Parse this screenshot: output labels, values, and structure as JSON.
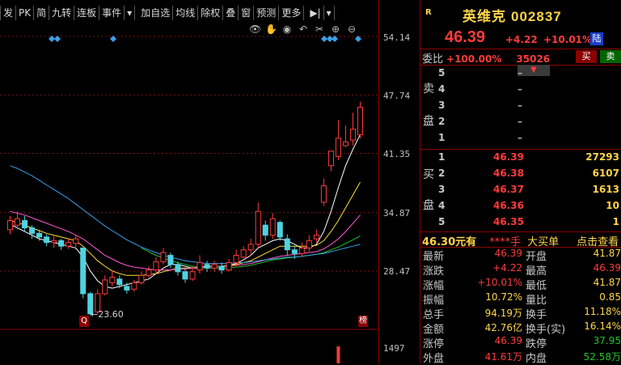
{
  "toolbar": {
    "items": [
      "发",
      "PK",
      "简",
      "九转",
      "连板",
      "事件",
      "▾",
      "加自选",
      "均线",
      "除权",
      "叠",
      "窗",
      "预测",
      "更多",
      "▶|",
      "▾"
    ]
  },
  "chart": {
    "price_axis": [
      "54.14",
      "47.74",
      "41.35",
      "34.87",
      "28.47"
    ],
    "volume_axis": "1497",
    "low_marker": "←23.60",
    "badge_low": "Q",
    "badge_high": "榜",
    "tool_icons": [
      "eye-icon",
      "hand-icon",
      "replay-icon",
      "undo-icon",
      "scissors-icon",
      "plus-circle-icon",
      "minus-circle-icon"
    ]
  },
  "chart_data": {
    "type": "candlestick",
    "y_axis_ticks": [
      28.47,
      34.87,
      41.35,
      47.74,
      54.14
    ],
    "lowest_price": 23.6,
    "candles": [
      {
        "o": 33.0,
        "c": 34.0,
        "h": 34.5,
        "l": 32.5
      },
      {
        "o": 33.5,
        "c": 34.2,
        "h": 35.0,
        "l": 33.0
      },
      {
        "o": 34.0,
        "c": 33.2,
        "h": 34.5,
        "l": 32.8
      },
      {
        "o": 33.2,
        "c": 32.6,
        "h": 33.5,
        "l": 32.0
      },
      {
        "o": 32.6,
        "c": 32.2,
        "h": 33.0,
        "l": 31.8
      },
      {
        "o": 32.2,
        "c": 31.6,
        "h": 32.5,
        "l": 31.2
      },
      {
        "o": 31.6,
        "c": 31.8,
        "h": 32.3,
        "l": 31.0
      },
      {
        "o": 31.8,
        "c": 31.2,
        "h": 32.0,
        "l": 30.8
      },
      {
        "o": 31.2,
        "c": 31.6,
        "h": 32.0,
        "l": 30.9
      },
      {
        "o": 31.5,
        "c": 32.0,
        "h": 32.4,
        "l": 31.1
      },
      {
        "o": 31.0,
        "c": 26.0,
        "h": 31.0,
        "l": 25.5
      },
      {
        "o": 26.0,
        "c": 23.8,
        "h": 26.2,
        "l": 23.6
      },
      {
        "o": 24.0,
        "c": 26.0,
        "h": 26.5,
        "l": 23.8
      },
      {
        "o": 26.0,
        "c": 27.5,
        "h": 28.0,
        "l": 25.8
      },
      {
        "o": 27.2,
        "c": 27.8,
        "h": 28.5,
        "l": 26.8
      },
      {
        "o": 27.6,
        "c": 27.0,
        "h": 28.0,
        "l": 26.6
      },
      {
        "o": 26.8,
        "c": 26.4,
        "h": 27.2,
        "l": 26.0
      },
      {
        "o": 26.5,
        "c": 27.2,
        "h": 27.5,
        "l": 26.2
      },
      {
        "o": 27.2,
        "c": 28.0,
        "h": 28.4,
        "l": 27.0
      },
      {
        "o": 28.0,
        "c": 28.6,
        "h": 29.0,
        "l": 27.8
      },
      {
        "o": 28.6,
        "c": 29.5,
        "h": 30.0,
        "l": 28.2
      },
      {
        "o": 29.5,
        "c": 30.5,
        "h": 31.0,
        "l": 29.2
      },
      {
        "o": 30.2,
        "c": 29.2,
        "h": 30.5,
        "l": 28.8
      },
      {
        "o": 29.2,
        "c": 28.4,
        "h": 29.5,
        "l": 28.0
      },
      {
        "o": 28.4,
        "c": 27.6,
        "h": 28.8,
        "l": 27.2
      },
      {
        "o": 27.6,
        "c": 28.4,
        "h": 29.0,
        "l": 27.4
      },
      {
        "o": 28.6,
        "c": 29.4,
        "h": 30.2,
        "l": 28.2
      },
      {
        "o": 29.2,
        "c": 28.8,
        "h": 29.6,
        "l": 28.4
      },
      {
        "o": 28.8,
        "c": 29.2,
        "h": 29.6,
        "l": 28.4
      },
      {
        "o": 29.0,
        "c": 28.6,
        "h": 29.4,
        "l": 28.2
      },
      {
        "o": 28.6,
        "c": 29.4,
        "h": 29.8,
        "l": 28.4
      },
      {
        "o": 29.4,
        "c": 30.2,
        "h": 30.8,
        "l": 29.0
      },
      {
        "o": 30.0,
        "c": 30.8,
        "h": 31.2,
        "l": 29.6
      },
      {
        "o": 30.8,
        "c": 31.4,
        "h": 32.0,
        "l": 30.2
      },
      {
        "o": 31.4,
        "c": 35.0,
        "h": 36.0,
        "l": 31.0
      },
      {
        "o": 33.5,
        "c": 32.4,
        "h": 34.0,
        "l": 31.8
      },
      {
        "o": 32.4,
        "c": 34.2,
        "h": 34.8,
        "l": 32.0
      },
      {
        "o": 33.8,
        "c": 32.2,
        "h": 34.0,
        "l": 31.8
      },
      {
        "o": 32.0,
        "c": 30.8,
        "h": 32.5,
        "l": 30.2
      },
      {
        "o": 30.8,
        "c": 30.4,
        "h": 31.2,
        "l": 29.8
      },
      {
        "o": 30.4,
        "c": 31.0,
        "h": 31.6,
        "l": 30.0
      },
      {
        "o": 31.0,
        "c": 31.8,
        "h": 32.4,
        "l": 30.6
      },
      {
        "o": 32.0,
        "c": 32.4,
        "h": 33.0,
        "l": 31.6
      },
      {
        "o": 36.0,
        "c": 37.8,
        "h": 38.6,
        "l": 35.6
      },
      {
        "o": 40.0,
        "c": 41.6,
        "h": 41.6,
        "l": 39.4
      },
      {
        "o": 41.0,
        "c": 43.0,
        "h": 45.0,
        "l": 40.6
      },
      {
        "o": 42.2,
        "c": 42.6,
        "h": 44.4,
        "l": 42.0
      },
      {
        "o": 42.8,
        "c": 44.0,
        "h": 45.8,
        "l": 42.2
      },
      {
        "o": 43.4,
        "c": 46.39,
        "h": 47.0,
        "l": 43.0
      }
    ],
    "ma_lines": [
      {
        "color": "#ffffff",
        "values": [
          33.6,
          33.2,
          32.8,
          32.4,
          32.0,
          31.8,
          31.6,
          31.4,
          31.2,
          31.0,
          30.0,
          28.5,
          27.4,
          26.8,
          26.6,
          26.8,
          27.0,
          27.2,
          27.4,
          27.6,
          28.2,
          28.8,
          29.2,
          29.2,
          29.0,
          28.8,
          28.8,
          28.9,
          29.0,
          29.0,
          29.1,
          29.3,
          29.7,
          30.2,
          31.0,
          31.4,
          31.8,
          32.0,
          31.8,
          31.4,
          31.0,
          31.0,
          31.4,
          32.8,
          35.0,
          37.6,
          40.0,
          41.8,
          43.4
        ]
      },
      {
        "color": "#ffe033",
        "values": [
          34.0,
          33.8,
          33.5,
          33.2,
          32.9,
          32.6,
          32.4,
          32.2,
          32.0,
          31.8,
          31.2,
          30.4,
          29.6,
          29.0,
          28.5,
          28.2,
          28.0,
          28.0,
          28.0,
          28.1,
          28.2,
          28.4,
          28.6,
          28.8,
          28.8,
          28.8,
          28.9,
          29.0,
          29.0,
          29.0,
          29.1,
          29.2,
          29.4,
          29.6,
          30.0,
          30.4,
          30.8,
          31.2,
          31.2,
          31.2,
          31.2,
          31.2,
          31.3,
          31.8,
          32.8,
          34.0,
          35.4,
          36.8,
          38.2
        ]
      },
      {
        "color": "#ff5ad0",
        "values": [
          35.0,
          34.8,
          34.6,
          34.3,
          34.0,
          33.7,
          33.4,
          33.1,
          32.8,
          32.4,
          32.0,
          31.4,
          30.8,
          30.2,
          29.8,
          29.4,
          29.1,
          28.9,
          28.8,
          28.7,
          28.6,
          28.6,
          28.6,
          28.7,
          28.7,
          28.8,
          28.9,
          28.9,
          29.0,
          29.0,
          29.0,
          29.1,
          29.2,
          29.3,
          29.5,
          29.7,
          29.9,
          30.1,
          30.2,
          30.3,
          30.4,
          30.5,
          30.6,
          30.9,
          31.4,
          32.0,
          32.8,
          33.7,
          34.6
        ]
      },
      {
        "color": "#22c22c",
        "values": [
          null,
          null,
          null,
          null,
          null,
          null,
          null,
          null,
          null,
          null,
          null,
          null,
          null,
          null,
          null,
          null,
          null,
          null,
          31.0,
          30.6,
          30.2,
          29.9,
          29.6,
          29.4,
          29.2,
          29.0,
          28.9,
          28.8,
          28.8,
          28.8,
          28.8,
          28.9,
          29.0,
          29.1,
          29.3,
          29.5,
          29.7,
          29.8,
          29.9,
          30.0,
          30.1,
          30.2,
          30.3,
          30.5,
          30.8,
          31.1,
          31.5,
          31.9,
          32.3
        ]
      },
      {
        "color": "#3aa0e8",
        "values": [
          40.0,
          39.7,
          39.3,
          38.9,
          38.4,
          37.9,
          37.4,
          36.9,
          36.4,
          35.8,
          35.2,
          34.6,
          34.0,
          33.4,
          32.9,
          32.4,
          31.9,
          31.5,
          31.1,
          30.8,
          30.5,
          30.2,
          30.0,
          29.8,
          29.6,
          29.5,
          29.4,
          29.3,
          29.3,
          29.3,
          29.3,
          29.4,
          29.4,
          29.5,
          29.6,
          29.7,
          29.8,
          29.9,
          30.0,
          30.0,
          30.1,
          30.2,
          30.3,
          30.4,
          30.6,
          30.8,
          31.0,
          31.2,
          31.4
        ]
      }
    ],
    "volume_bars": [
      1497
    ]
  },
  "quote": {
    "name": "英维克",
    "code": "002837",
    "price": "46.39",
    "change": "+4.22",
    "change_pct": "+10.01%",
    "market_badge": "陆",
    "r_mark": "R"
  },
  "weibi": {
    "label": "委比",
    "value": "+100.00%",
    "diff": "35026",
    "buy_btn": "买",
    "sell_btn": "卖"
  },
  "orderbook": {
    "sell_label": [
      "卖",
      "盘"
    ],
    "buy_label": [
      "买",
      "盘"
    ],
    "sell": [
      {
        "idx": "5",
        "price": "–",
        "vol": ""
      },
      {
        "idx": "4",
        "price": "–",
        "vol": ""
      },
      {
        "idx": "3",
        "price": "–",
        "vol": ""
      },
      {
        "idx": "2",
        "price": "–",
        "vol": ""
      },
      {
        "idx": "1",
        "price": "–",
        "vol": ""
      }
    ],
    "buy": [
      {
        "idx": "1",
        "price": "46.39",
        "vol": "27293"
      },
      {
        "idx": "2",
        "price": "46.38",
        "vol": "6107"
      },
      {
        "idx": "3",
        "price": "46.37",
        "vol": "1613"
      },
      {
        "idx": "4",
        "price": "46.36",
        "vol": "10"
      },
      {
        "idx": "5",
        "price": "46.35",
        "vol": "1"
      }
    ]
  },
  "summary": {
    "price": "46.30元有",
    "stars": "****手",
    "big": "大买单",
    "link": "点击查看"
  },
  "stats": [
    {
      "l1": "最新",
      "v1": "46.39",
      "l2": "开盘",
      "v2": "41.87",
      "c2": "yellow"
    },
    {
      "l1": "涨跌",
      "v1": "+4.22",
      "l2": "最高",
      "v2": "46.39",
      "c2": ""
    },
    {
      "l1": "涨幅",
      "v1": "+10.01%",
      "l2": "最低",
      "v2": "41.87",
      "c2": "yellow"
    },
    {
      "l1": "振幅",
      "v1": "10.72%",
      "l2": "量比",
      "v2": "0.85",
      "c2": "yellow",
      "c1": "yellow"
    },
    {
      "l1": "总手",
      "v1": "94.19万",
      "l2": "换手",
      "v2": "11.18%",
      "c1": "yellow",
      "c2": "yellow"
    },
    {
      "l1": "金额",
      "v1": "42.76亿",
      "l2": "换手(实)",
      "v2": "16.14%",
      "c1": "yellow",
      "c2": "yellow"
    },
    {
      "l1": "涨停",
      "v1": "46.39",
      "l2": "跌停",
      "v2": "37.95",
      "c2": "green"
    },
    {
      "l1": "外盘",
      "v1": "41.61万",
      "l2": "内盘",
      "v2": "52.58万",
      "c2": "green"
    }
  ]
}
